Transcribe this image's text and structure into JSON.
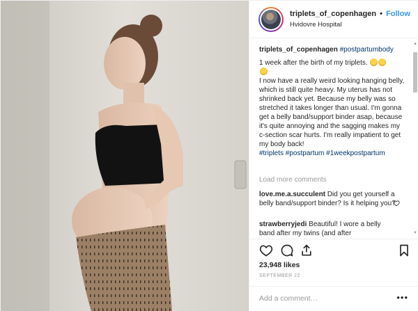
{
  "header": {
    "username": "triplets_of_copenhagen",
    "separator": "•",
    "follow_label": "Follow",
    "location": "Hvidovre Hospital"
  },
  "caption": {
    "username": "triplets_of_copenhagen",
    "tag_postpartum": "#postpartumbody",
    "line1": "1 week after the birth of my triplets.",
    "body": "I now have a really weird looking hanging belly, which is still quite heavy. My uterus has not shrinked back yet. Because my belly was so stretched it takes longer than usual. I'm gonna get a belly band/support binder asap, because it's quite annoying and the sagging makes my c-section scar hurts. I'm really impatient to get my body back!",
    "hashtags": "#triplets #postpartum #1weekpostpartum"
  },
  "load_more": "Load more comments",
  "comments": [
    {
      "username": "love.me.a.succulent",
      "text": "Did you get yourself a belly band/support binder? Is it helping you?"
    },
    {
      "username": "strawberryjedi",
      "text": "Beautiful! I wore a belly band after my twins (and after"
    }
  ],
  "icons": {
    "like": "heart-outline",
    "comment": "speech-bubble",
    "share": "share-arrow",
    "save": "bookmark",
    "more": "ellipsis"
  },
  "likes": "23,948 likes",
  "date": "SEPTEMBER 22",
  "add_comment": {
    "placeholder": "Add a comment…"
  },
  "more_label": "•••",
  "colors": {
    "link": "#3897f0",
    "hashtag": "#003569",
    "muted": "#999999",
    "text": "#262626"
  }
}
